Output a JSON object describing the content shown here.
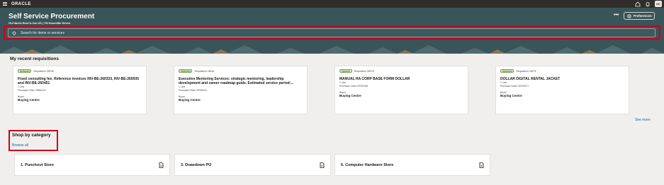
{
  "topbar": {
    "logo": "ORACLE",
    "user_initials": "HC",
    "icons": [
      "menu-icon",
      "home-icon",
      "bell-icon"
    ]
  },
  "hero": {
    "title": "Self Service Procurement",
    "subtitle": "OU Harris Rent A Car US | TN Knoxville Seven",
    "more": "•••",
    "preferences_label": "Preferences",
    "search_placeholder": "Search for items or services"
  },
  "recent": {
    "title": "My recent requisitions",
    "see_more": "See more",
    "cards": [
      {
        "status": "Delivered",
        "requisition": "Requisition 28708",
        "title": "Fixed consulting fee. Reference invoices INV-BE-260333, INV-BE-260505 and INV-BE-260451",
        "lines": "1 Line",
        "po": "Purchase Order 29800147",
        "buyer_label": "Buyer",
        "buyer": "Buying Centre"
      },
      {
        "status": "Delivered",
        "requisition": "Requisition 28444",
        "title": "Executive Mentoring Services: strategic mentoring, leadership development and career roadmap guide. Estimated service period:...",
        "lines": "1 Line",
        "po": "Purchase Order 29760814",
        "buyer_label": "Buyer",
        "buyer": "Buying Centre"
      },
      {
        "status": "Ordered",
        "requisition": "Requisition 28276",
        "title": "MANUAL RA CORP BASE FORM DOLLAR",
        "lines": "1 Line",
        "po": "Purchase Order 29706768",
        "buyer_label": "Buyer",
        "buyer": "Buying Centre"
      },
      {
        "status": "Delivered",
        "requisition": "Requisition 28275",
        "title": "DOLLAR DIGITAL RENTAL JACKET",
        "lines": "1 Line",
        "po": "Purchase Order 29703371",
        "buyer_label": "Buyer",
        "buyer": "Buying Centre"
      }
    ]
  },
  "shop": {
    "title": "Shop by category",
    "browse_all": "Browse all",
    "categories": [
      {
        "label": "1. Punchout Store"
      },
      {
        "label": "3. Drawdown PO"
      },
      {
        "label": "6. Computer Hardware Store"
      }
    ]
  },
  "colors": {
    "hero_bg": "#3a5559",
    "topbar_bg": "#312d2a",
    "highlight": "#d0001d",
    "link": "#1f5f8b",
    "badge_bg": "#d9eac6"
  }
}
